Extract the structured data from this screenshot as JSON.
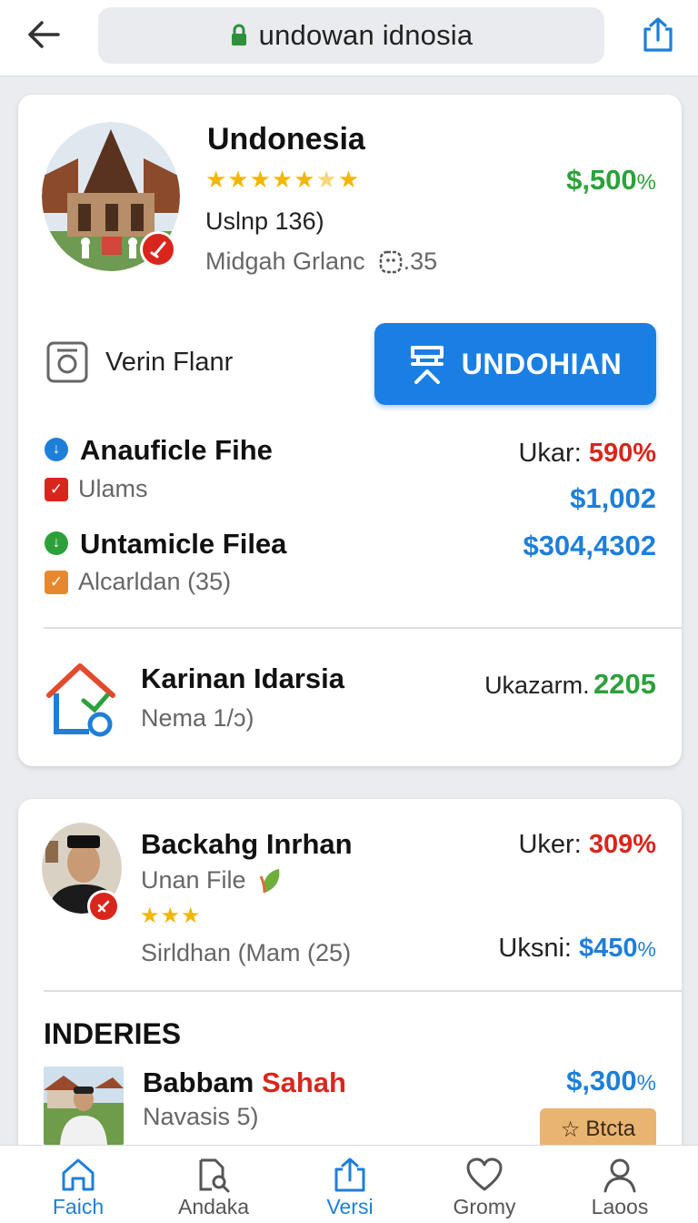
{
  "browser": {
    "url": "undowan idnosia"
  },
  "card1": {
    "name": "Undonesia",
    "rating_stars": "★★★★★",
    "price": "$,500",
    "price_unit": "%",
    "info1": "Uslnp 136)",
    "info2": "Midgah Grlanc",
    "info2_extra": ".35",
    "verify_label": "Verin Flanr",
    "cta_label": "UNDOHIAN",
    "items": [
      {
        "title": "Anauficle Fihe",
        "sub": "Ulams",
        "right1_label": "Ukar:",
        "right1_value": "590%",
        "right2": "$1,002"
      },
      {
        "title": "Untamicle Filea",
        "sub": "Alcarldan (35)",
        "right1": "$304,4302"
      }
    ],
    "footer": {
      "title": "Karinan Idarsia",
      "sub": "Nema 1/ɔ)",
      "stat_label": "Ukazarm.",
      "stat_value": "2205"
    }
  },
  "card2": {
    "person": {
      "name": "Backahg Inrhan",
      "sub": "Unan File",
      "stars": "★★★",
      "location": "Sirldhan (Mam (25)",
      "stat1_label": "Uker:",
      "stat1_value": "309%",
      "stat2_label": "Uksni:",
      "stat2_value": "$450",
      "stat2_unit": "%"
    },
    "section_title": "INDERIES",
    "listing": {
      "name_part1": "Babbam",
      "name_part2": "Sahah",
      "sub": "Navasis 5)",
      "price": "$,300",
      "price_unit": "%",
      "tag": "Btcta"
    }
  },
  "nav": {
    "items": [
      {
        "label": "Faich",
        "icon": "home-icon",
        "active": true
      },
      {
        "label": "Andaka",
        "icon": "search-doc-icon",
        "active": false
      },
      {
        "label": "Versi",
        "icon": "share-icon",
        "active": true
      },
      {
        "label": "Gromy",
        "icon": "heart-icon",
        "active": false
      },
      {
        "label": "Laoos",
        "icon": "profile-icon",
        "active": false
      }
    ]
  },
  "colors": {
    "accent": "#1a7fe2",
    "green": "#2ca13a",
    "red": "#d9261c"
  }
}
